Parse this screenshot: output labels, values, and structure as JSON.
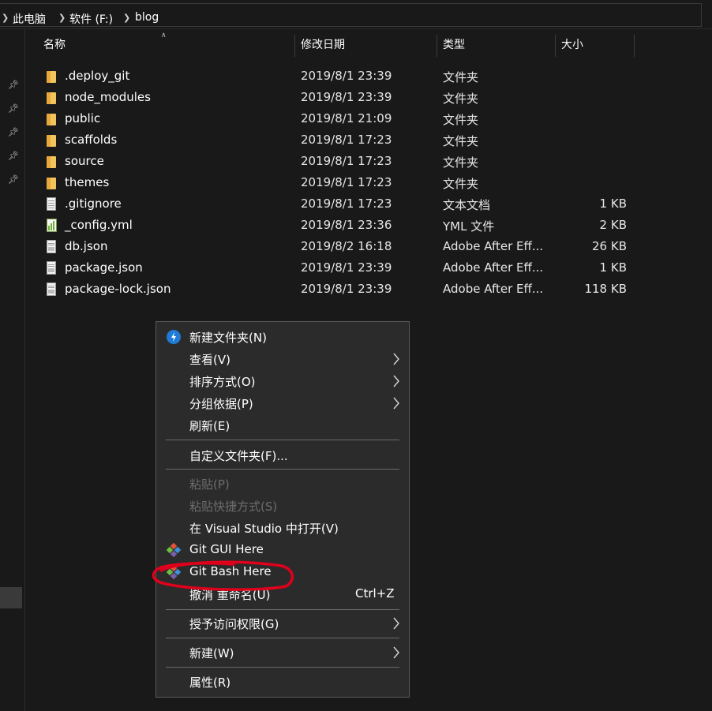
{
  "breadcrumb": {
    "items": [
      "此电脑",
      "软件 (F:)",
      "blog"
    ]
  },
  "columns": {
    "name": "名称",
    "date": "修改日期",
    "type": "类型",
    "size": "大小"
  },
  "files": [
    {
      "name": ".deploy_git",
      "date": "2019/8/1 23:39",
      "type": "文件夹",
      "size": "",
      "icon": "folder-icon"
    },
    {
      "name": "node_modules",
      "date": "2019/8/1 23:39",
      "type": "文件夹",
      "size": "",
      "icon": "folder-icon"
    },
    {
      "name": "public",
      "date": "2019/8/1 21:09",
      "type": "文件夹",
      "size": "",
      "icon": "folder-icon"
    },
    {
      "name": "scaffolds",
      "date": "2019/8/1 17:23",
      "type": "文件夹",
      "size": "",
      "icon": "folder-icon"
    },
    {
      "name": "source",
      "date": "2019/8/1 17:23",
      "type": "文件夹",
      "size": "",
      "icon": "folder-icon"
    },
    {
      "name": "themes",
      "date": "2019/8/1 17:23",
      "type": "文件夹",
      "size": "",
      "icon": "folder-icon"
    },
    {
      "name": ".gitignore",
      "date": "2019/8/1 17:23",
      "type": "文本文档",
      "size": "1 KB",
      "icon": "text-file-icon"
    },
    {
      "name": "_config.yml",
      "date": "2019/8/1 23:36",
      "type": "YML 文件",
      "size": "2 KB",
      "icon": "yml-file-icon"
    },
    {
      "name": "db.json",
      "date": "2019/8/2 16:18",
      "type": "Adobe After Eff...",
      "size": "26 KB",
      "icon": "json-file-icon"
    },
    {
      "name": "package.json",
      "date": "2019/8/1 23:39",
      "type": "Adobe After Eff...",
      "size": "1 KB",
      "icon": "json-file-icon"
    },
    {
      "name": "package-lock.json",
      "date": "2019/8/1 23:39",
      "type": "Adobe After Eff...",
      "size": "118 KB",
      "icon": "json-file-icon"
    }
  ],
  "context_menu": {
    "items": [
      {
        "label": "新建文件夹(N)",
        "icon": "new-folder-icon",
        "submenu": false,
        "disabled": false,
        "shortcut": ""
      },
      {
        "label": "查看(V)",
        "icon": "",
        "submenu": true,
        "disabled": false,
        "shortcut": ""
      },
      {
        "label": "排序方式(O)",
        "icon": "",
        "submenu": true,
        "disabled": false,
        "shortcut": ""
      },
      {
        "label": "分组依据(P)",
        "icon": "",
        "submenu": true,
        "disabled": false,
        "shortcut": ""
      },
      {
        "label": "刷新(E)",
        "icon": "",
        "submenu": false,
        "disabled": false,
        "shortcut": ""
      },
      {
        "label": "自定义文件夹(F)...",
        "icon": "",
        "submenu": false,
        "disabled": false,
        "shortcut": ""
      },
      {
        "label": "粘贴(P)",
        "icon": "",
        "submenu": false,
        "disabled": true,
        "shortcut": ""
      },
      {
        "label": "粘贴快捷方式(S)",
        "icon": "",
        "submenu": false,
        "disabled": true,
        "shortcut": ""
      },
      {
        "label": "在 Visual Studio 中打开(V)",
        "icon": "",
        "submenu": false,
        "disabled": false,
        "shortcut": ""
      },
      {
        "label": "Git GUI Here",
        "icon": "git-icon",
        "submenu": false,
        "disabled": false,
        "shortcut": ""
      },
      {
        "label": "Git Bash Here",
        "icon": "git-icon",
        "submenu": false,
        "disabled": false,
        "shortcut": ""
      },
      {
        "label": "撤消 重命名(U)",
        "icon": "",
        "submenu": false,
        "disabled": false,
        "shortcut": "Ctrl+Z"
      },
      {
        "label": "授予访问权限(G)",
        "icon": "",
        "submenu": true,
        "disabled": false,
        "shortcut": ""
      },
      {
        "label": "新建(W)",
        "icon": "",
        "submenu": true,
        "disabled": false,
        "shortcut": ""
      },
      {
        "label": "属性(R)",
        "icon": "",
        "submenu": false,
        "disabled": false,
        "shortcut": ""
      }
    ]
  },
  "colors": {
    "background": "#191919",
    "menu_background": "#2b2b2b",
    "annotation": "#e0001b",
    "folder": "#f2c55c"
  }
}
